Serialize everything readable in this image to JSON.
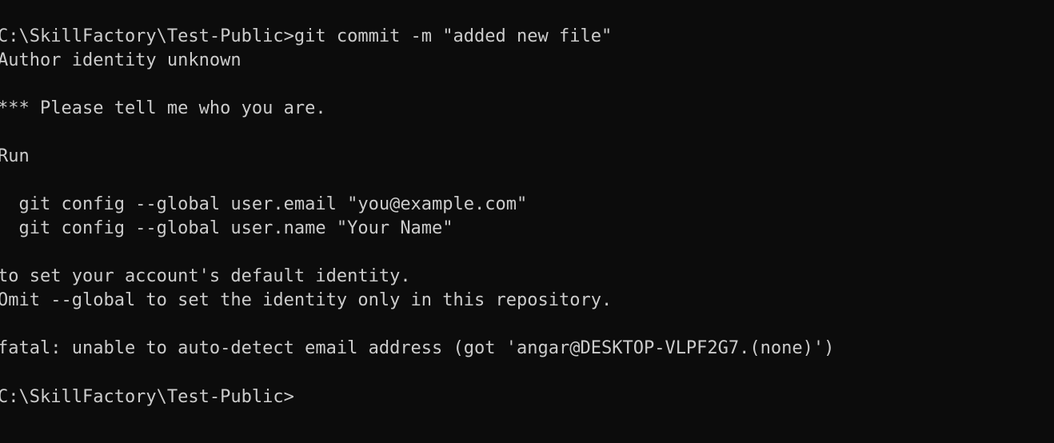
{
  "colors": {
    "background": "#0c0c0c",
    "foreground": "#cccccc"
  },
  "terminal": {
    "lines": [
      "C:\\SkillFactory\\Test-Public>git commit -m \"added new file\"",
      "Author identity unknown",
      "",
      "*** Please tell me who you are.",
      "",
      "Run",
      "",
      "  git config --global user.email \"you@example.com\"",
      "  git config --global user.name \"Your Name\"",
      "",
      "to set your account's default identity.",
      "Omit --global to set the identity only in this repository.",
      "",
      "fatal: unable to auto-detect email address (got 'angar@DESKTOP-VLPF2G7.(none)')",
      "",
      "C:\\SkillFactory\\Test-Public>"
    ]
  }
}
